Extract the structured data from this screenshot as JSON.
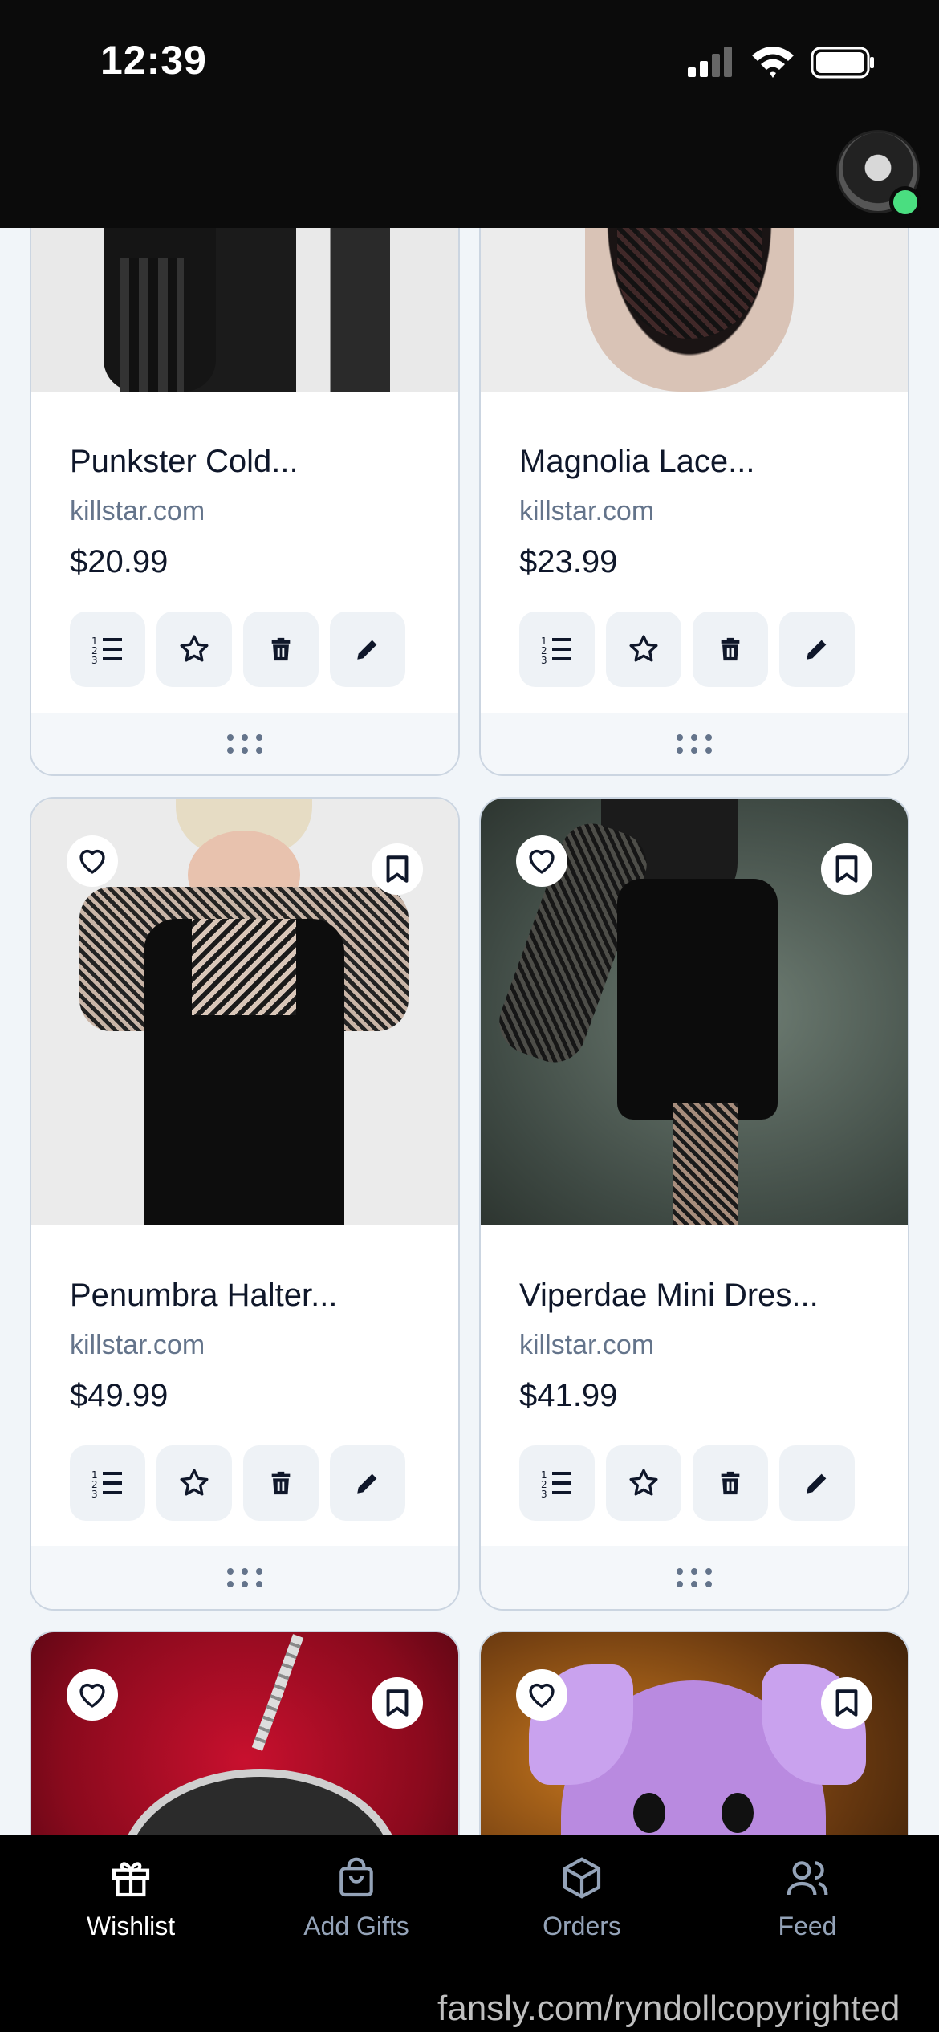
{
  "status_bar": {
    "time": "12:39"
  },
  "products": [
    {
      "title": "Punkster Cold...",
      "source": "killstar.com",
      "price": "$20.99"
    },
    {
      "title": "Magnolia Lace...",
      "source": "killstar.com",
      "price": "$23.99"
    },
    {
      "title": "Penumbra Halter...",
      "source": "killstar.com",
      "price": "$49.99"
    },
    {
      "title": "Viperdae Mini Dres...",
      "source": "killstar.com",
      "price": "$41.99"
    }
  ],
  "tabs": [
    {
      "label": "Wishlist"
    },
    {
      "label": "Add Gifts"
    },
    {
      "label": "Orders"
    },
    {
      "label": "Feed"
    }
  ],
  "watermark": "fansly.com/ryndollcopyrighted",
  "colors": {
    "accent_online": "#4ade80",
    "tab_active": "#ffffff",
    "tab_inactive": "#94a3b8"
  }
}
